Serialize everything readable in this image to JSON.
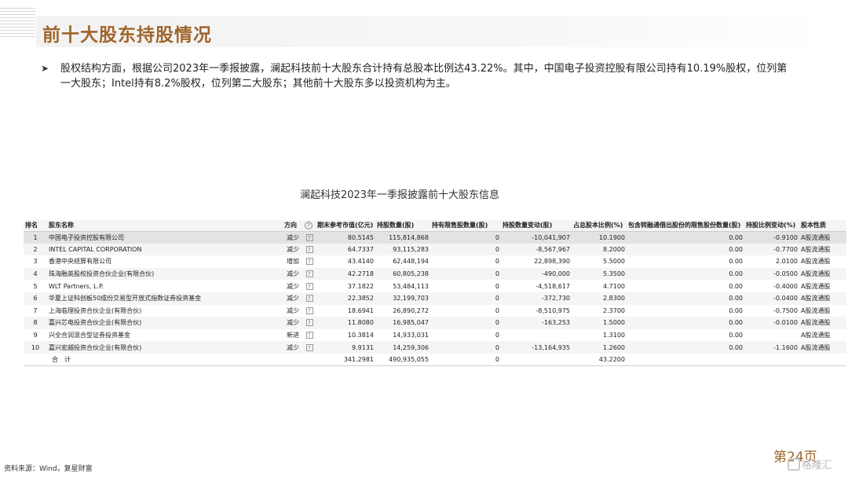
{
  "page": {
    "title": "前十大股东持股情况",
    "bullet": "股权结构方面，根据公司2023年一季报披露，澜起科技前十大股东合计持有总股本比例达43.22%。其中，中国电子投资控股有限公司持有10.19%股权，位列第一大股东；Intel持有8.2%股权，位列第二大股东；其他前十大股东多以投资机构为主。",
    "bullet_icon": "arrow-bullet-icon"
  },
  "table": {
    "caption": "澜起科技2023年一季报披露前十大股东信息",
    "headers": {
      "rank": "排名",
      "name": "股东名称",
      "direction": "方向",
      "help": "?",
      "market_value": "期末参考市值(亿元)",
      "shares": "持股数量(股)",
      "restricted": "持有限售股数量(股)",
      "change": "持股数量变动(股)",
      "ratio": "占总股本比例(%)",
      "lent": "包含转融通借出股份的限售股份数量(股)",
      "ratio_change": "持股比例变动(%)",
      "nature": "股本性质"
    },
    "help_mark": "?",
    "rows": [
      {
        "rank": "1",
        "name": "中国电子投资控股有限公司",
        "direction": "减少",
        "market_value": "80.5145",
        "shares": "115,814,868",
        "restricted": "0",
        "change": "-10,041,907",
        "ratio": "10.1900",
        "lent": "0.00",
        "ratio_change": "-0.9100",
        "nature": "A股流通股"
      },
      {
        "rank": "2",
        "name": "INTEL CAPITAL CORPORATION",
        "direction": "减少",
        "market_value": "64.7337",
        "shares": "93,115,283",
        "restricted": "0",
        "change": "-8,567,967",
        "ratio": "8.2000",
        "lent": "0.00",
        "ratio_change": "-0.7700",
        "nature": "A股流通股"
      },
      {
        "rank": "3",
        "name": "香港中央结算有限公司",
        "direction": "增加",
        "market_value": "43.4140",
        "shares": "62,448,194",
        "restricted": "0",
        "change": "22,898,390",
        "ratio": "5.5000",
        "lent": "0.00",
        "ratio_change": "2.0100",
        "nature": "A股流通股"
      },
      {
        "rank": "4",
        "name": "珠海融英股权投资合伙企业(有限合伙)",
        "direction": "减少",
        "market_value": "42.2718",
        "shares": "60,805,238",
        "restricted": "0",
        "change": "-490,000",
        "ratio": "5.3500",
        "lent": "0.00",
        "ratio_change": "-0.0500",
        "nature": "A股流通股"
      },
      {
        "rank": "5",
        "name": "WLT Partners, L.P.",
        "direction": "减少",
        "market_value": "37.1822",
        "shares": "53,484,113",
        "restricted": "0",
        "change": "-4,518,617",
        "ratio": "4.7100",
        "lent": "0.00",
        "ratio_change": "-0.4000",
        "nature": "A股流通股"
      },
      {
        "rank": "6",
        "name": "华夏上证科创板50成份交易型开放式指数证券投资基金",
        "direction": "减少",
        "market_value": "22.3852",
        "shares": "32,199,703",
        "restricted": "0",
        "change": "-372,730",
        "ratio": "2.8300",
        "lent": "0.00",
        "ratio_change": "-0.0400",
        "nature": "A股流通股"
      },
      {
        "rank": "7",
        "name": "上海临理投资合伙企业(有限合伙)",
        "direction": "减少",
        "market_value": "18.6941",
        "shares": "26,890,272",
        "restricted": "0",
        "change": "-8,510,975",
        "ratio": "2.3700",
        "lent": "0.00",
        "ratio_change": "-0.7500",
        "nature": "A股流通股"
      },
      {
        "rank": "8",
        "name": "嘉兴芯电投资合伙企业(有限合伙)",
        "direction": "减少",
        "market_value": "11.8080",
        "shares": "16,985,047",
        "restricted": "0",
        "change": "-163,253",
        "ratio": "1.5000",
        "lent": "0.00",
        "ratio_change": "-0.0100",
        "nature": "A股流通股"
      },
      {
        "rank": "9",
        "name": "兴全合润混合型证券投资基金",
        "direction": "新进",
        "market_value": "10.3814",
        "shares": "14,933,031",
        "restricted": "0",
        "change": "",
        "ratio": "1.3100",
        "lent": "0.00",
        "ratio_change": "",
        "nature": "A股流通股"
      },
      {
        "rank": "10",
        "name": "嘉兴宏越投资合伙企业(有限合伙)",
        "direction": "减少",
        "market_value": "9.9131",
        "shares": "14,259,306",
        "restricted": "0",
        "change": "-13,164,935",
        "ratio": "1.2600",
        "lent": "0.00",
        "ratio_change": "-1.1600",
        "nature": "A股流通股"
      }
    ],
    "total": {
      "label": "合　计",
      "market_value": "341.2981",
      "shares": "490,935,055",
      "restricted": "0",
      "ratio": "43.2200"
    }
  },
  "footer": {
    "source": "资料来源：Wind，复星财富",
    "page_number": "第24页",
    "brand": "格隆汇",
    "brand_icon": "gelonghui-logo-icon"
  },
  "colors": {
    "title": "#a0652a",
    "decrease": "#3e9a3e",
    "increase": "#d12a2a",
    "new_entry": "#e08a17",
    "negative_value": "#d12a2a"
  }
}
